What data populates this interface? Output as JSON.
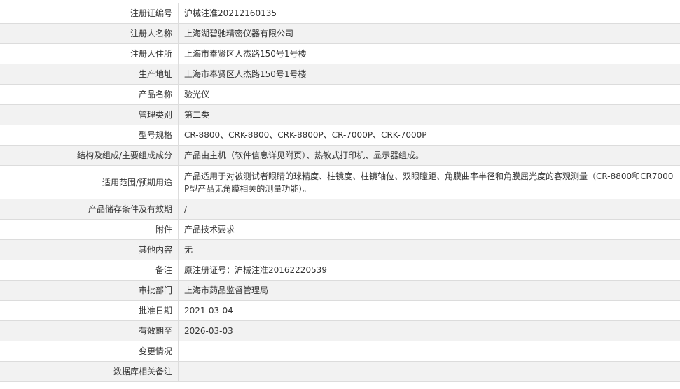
{
  "record": {
    "rows": [
      {
        "label": "注册证编号",
        "value": "沪械注准20212160135"
      },
      {
        "label": "注册人名称",
        "value": "上海湖碧驰精密仪器有限公司"
      },
      {
        "label": "注册人住所",
        "value": "上海市奉贤区人杰路150号1号楼"
      },
      {
        "label": "生产地址",
        "value": "上海市奉贤区人杰路150号1号楼"
      },
      {
        "label": "产品名称",
        "value": "验光仪"
      },
      {
        "label": "管理类别",
        "value": "第二类"
      },
      {
        "label": "型号规格",
        "value": "CR-8800、CRK-8800、CRK-8800P、CR-7000P、CRK-7000P"
      },
      {
        "label": "结构及组成/主要组成成分",
        "value": "产品由主机（软件信息详见附页）、热敏式打印机、显示器组成。"
      },
      {
        "label": "适用范围/预期用途",
        "value": "产品适用于对被测试者眼睛的球精度、柱镜度、柱镜轴位、双眼瞳距、角膜曲率半径和角膜屈光度的客观测量（CR-8800和CR7000P型产品无角膜相关的测量功能）。"
      },
      {
        "label": "产品储存条件及有效期",
        "value": "/"
      },
      {
        "label": "附件",
        "value": "产品技术要求"
      },
      {
        "label": "其他内容",
        "value": "无"
      },
      {
        "label": "备注",
        "value": "原注册证号：沪械注准20162220539"
      },
      {
        "label": "审批部门",
        "value": "上海市药品监督管理局"
      },
      {
        "label": "批准日期",
        "value": "2021-03-04"
      },
      {
        "label": "有效期至",
        "value": "2026-03-03"
      },
      {
        "label": "变更情况",
        "value": ""
      },
      {
        "label": "数据库相关备注",
        "value": ""
      }
    ]
  }
}
